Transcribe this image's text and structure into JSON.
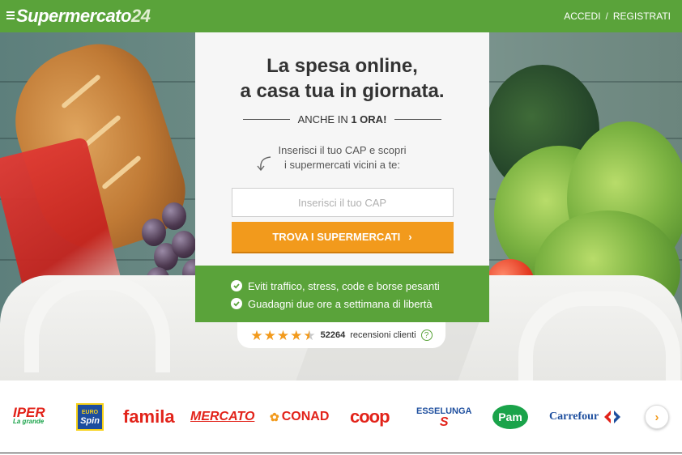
{
  "header": {
    "logo_text": "Supermercato",
    "logo_num": "24",
    "login_label": "ACCEDI",
    "separator": "/",
    "register_label": "REGISTRATI"
  },
  "card": {
    "headline_line1": "La spesa online,",
    "headline_line2": "a casa tua in giornata.",
    "sub_prefix": "ANCHE IN",
    "sub_bold": "1 ORA!",
    "hint_line1": "Inserisci il tuo CAP e scopri",
    "hint_line2": "i supermercati vicini a te:",
    "input_placeholder": "Inserisci il tuo CAP",
    "input_value": "",
    "cta_label": "TROVA I SUPERMERCATI",
    "cta_arrow": "›"
  },
  "benefits": [
    "Eviti traffico, stress, code e borse pesanti",
    "Guadagni due ore a settimana di libertà"
  ],
  "reviews": {
    "rating_stars": 4.5,
    "count": "52264",
    "label": "recensioni clienti",
    "help": "?"
  },
  "brands": [
    {
      "name": "iper-logo",
      "text": "IPER",
      "sub": "La grande",
      "color": "#e2231a"
    },
    {
      "name": "eurospin-logo",
      "text": "Spin",
      "sub": "EURO",
      "color": "#1d4e9e"
    },
    {
      "name": "famila-logo",
      "text": "famila",
      "color": "#e2231a"
    },
    {
      "name": "mercato-logo",
      "text": "MERCATO",
      "color": "#e2231a"
    },
    {
      "name": "conad-logo",
      "text": "CONAD",
      "color": "#e2231a"
    },
    {
      "name": "coop-logo",
      "text": "coop",
      "color": "#e2231a"
    },
    {
      "name": "esselunga-logo",
      "text": "ESSELUNGA",
      "color": "#1d4e9e"
    },
    {
      "name": "pam-logo",
      "text": "Pam",
      "color": "#1aa34a"
    },
    {
      "name": "carrefour-logo",
      "text": "Carrefour",
      "color": "#1d4e9e"
    }
  ],
  "next_arrow": "›",
  "colors": {
    "brand_green": "#5aa33a",
    "cta_orange": "#f29a1c"
  }
}
